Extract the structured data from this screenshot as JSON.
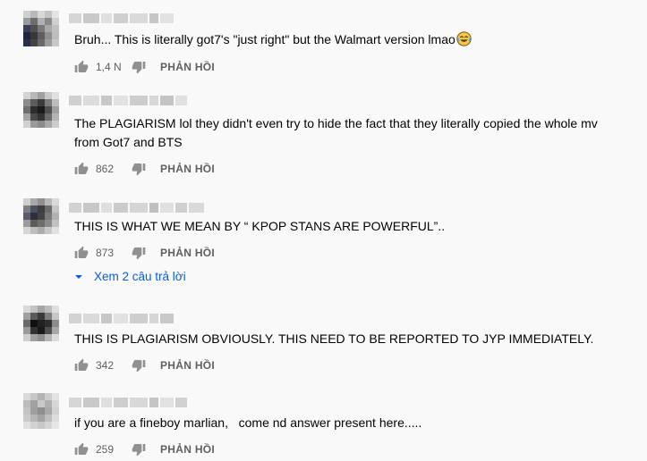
{
  "comments": [
    {
      "text": "Bruh... This is literally got7's \"just right\" but the Walmart version lmao",
      "emoji": "laughing-emoji",
      "likes": "1,4 N",
      "reply_label": "PHẢN HỒI",
      "avatar": [
        "#cfcfcf",
        "#b9b9b9",
        "#d8d8d8",
        "#c4c4c4",
        "#e4e4e4",
        "#9a9a9a",
        "#6d6d6d",
        "#b0b0b0",
        "#8a8a8a",
        "#d0d0d0",
        "#3a3f55",
        "#505050",
        "#7a7a7a",
        "#a8a8a8",
        "#c0c0c0",
        "#1f2440",
        "#383838",
        "#5e5e5e",
        "#8f8f8f",
        "#bdbdbd",
        "#2a2f48",
        "#444",
        "#6a6a6a",
        "#9c9c9c",
        "#c8c8c8"
      ],
      "author": [
        "#d6d6d6",
        "#c9c9c9",
        "#e0e0e0",
        "#cfcfcf",
        "#dadada",
        "#c6c6c6",
        "#e2e2e2"
      ]
    },
    {
      "text": "The PLAGIARISM lol they didn't even try to hide the fact that they literally copied the whole mv from Got7 and BTS",
      "likes": "862",
      "reply_label": "PHẢN HỒI",
      "avatar": [
        "#d4d4d4",
        "#b8b8b8",
        "#a0a0a0",
        "#c9c9c9",
        "#e0e0e0",
        "#8c8c8c",
        "#5c5c5c",
        "#3c3c3c",
        "#7b7b7b",
        "#bdbdbd",
        "#6f6f6f",
        "#2d2d2d",
        "#1c1c1c",
        "#4f4f4f",
        "#9e9e9e",
        "#a3a3a3",
        "#4a4a4a",
        "#333",
        "#6b6b6b",
        "#b4b4b4",
        "#d0d0d0",
        "#9a9a9a",
        "#8a8a8a",
        "#a8a8a8",
        "#cccccc"
      ],
      "author": [
        "#d0d0d0",
        "#dcdcdc",
        "#c8c8c8",
        "#e2e2e2",
        "#cdcdcd",
        "#d8d8d8",
        "#c4c4c4",
        "#e0e0e0"
      ]
    },
    {
      "text": "THIS IS WHAT WE MEAN BY “ KPOP STANS ARE POWERFUL”..",
      "likes": "873",
      "reply_label": "PHẢN HỒI",
      "view_replies": "Xem 2 câu trả lời",
      "avatar": [
        "#cfcfcf",
        "#a9a9a9",
        "#8f8f8f",
        "#b7b7b7",
        "#d9d9d9",
        "#7e7e7e",
        "#4d4f63",
        "#3e3e3e",
        "#6b6b6b",
        "#c4c4c4",
        "#5a5a6e",
        "#2f2f3a",
        "#434343",
        "#7a7a7a",
        "#b2b2b2",
        "#9b9b9b",
        "#5c5c5c",
        "#6d6d6d",
        "#8a8a8a",
        "#c1c1c1",
        "#d6d6d6",
        "#bebebe",
        "#acacac",
        "#c7c7c7",
        "#e1e1e1"
      ],
      "author": [
        "#d2d2d2",
        "#c8c8c8",
        "#dedede",
        "#cbcbcb",
        "#d5d5d5",
        "#bfbfbf",
        "#e0e0e0",
        "#cfcfcf",
        "#d9d9d9"
      ]
    },
    {
      "text": "THIS IS PLAGIARISM OBVIOUSLY. THIS NEED TO BE REPORTED TO JYP IMMEDIATELY.",
      "likes": "342",
      "reply_label": "PHẢN HỒI",
      "avatar": [
        "#d8d8d8",
        "#c2c2c2",
        "#a5a5a5",
        "#bcbcbc",
        "#dedede",
        "#9f9f9f",
        "#5b5b5b",
        "#3a3a3a",
        "#7d7d7d",
        "#c6c6c6",
        "#6a6a6a",
        "#111",
        "#222",
        "#2e2e2e",
        "#8c8c8c",
        "#9a9a9a",
        "#333",
        "#1a1a1a",
        "#4e4e4e",
        "#a7a7a7",
        "#cfcfcf",
        "#a0a0a0",
        "#8e8e8e",
        "#b5b5b5",
        "#dbdbdb"
      ],
      "author": [
        "#d3d3d3",
        "#dadada",
        "#c7c7c7",
        "#e1e1e1",
        "#cecece",
        "#d6d6d6",
        "#c9c9c9"
      ]
    },
    {
      "text": "if you are a fineboy marlian,   come nd answer present here.....",
      "likes": "259",
      "reply_label": "PHẢN HỒI",
      "avatar": [
        "#d9d9d9",
        "#c7c7c7",
        "#b3b3b3",
        "#cdcdcd",
        "#e3e3e3",
        "#bcbcbc",
        "#a1a1a1",
        "#c9c9c9",
        "#b0b0b0",
        "#d7d7d7",
        "#c4c4c4",
        "#9f9f9f",
        "#8e8e8e",
        "#a8a8a8",
        "#d1d1d1",
        "#cbcbcb",
        "#b6b6b6",
        "#a4a4a4",
        "#bfbfbf",
        "#dcdcdc",
        "#e0e0e0",
        "#d2d2d2",
        "#c8c8c8",
        "#d5d5d5",
        "#e6e6e6"
      ],
      "author": [
        "#d6d6d6",
        "#c9c9c9",
        "#dfdfdf",
        "#cdcdcd",
        "#d8d8d8",
        "#c5c5c5",
        "#e1e1e1",
        "#d1d1d1"
      ]
    }
  ]
}
